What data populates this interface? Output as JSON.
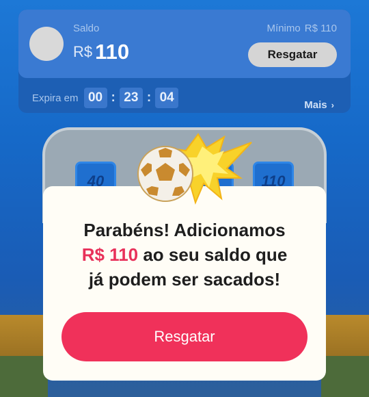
{
  "balance_card": {
    "saldo_label": "Saldo",
    "currency": "R$",
    "amount": "110",
    "minimo_label": "Mínimo",
    "minimo_value": "R$ 110",
    "resgatar_label": "Resgatar",
    "expira_label": "Expira em",
    "timer": {
      "hours": "00",
      "minutes": "23",
      "seconds": "04"
    },
    "mais_label": "Mais",
    "mais_icon": "chevron-right-icon"
  },
  "background_reels": [
    "40",
    "",
    "110"
  ],
  "modal": {
    "line1": "Parabéns! Adicionamos",
    "amount": "R$ 110",
    "line2_rest": " ao seu saldo que",
    "line3": "já podem ser sacados!",
    "button_label": "Resgatar",
    "icon": "soccer-ball-icon"
  },
  "colors": {
    "background": "#1d78d6",
    "card": "#1d5fb4",
    "modal_button": "#f0315a",
    "accent_text": "#e8315a",
    "modal_bg": "#fffdf6"
  }
}
